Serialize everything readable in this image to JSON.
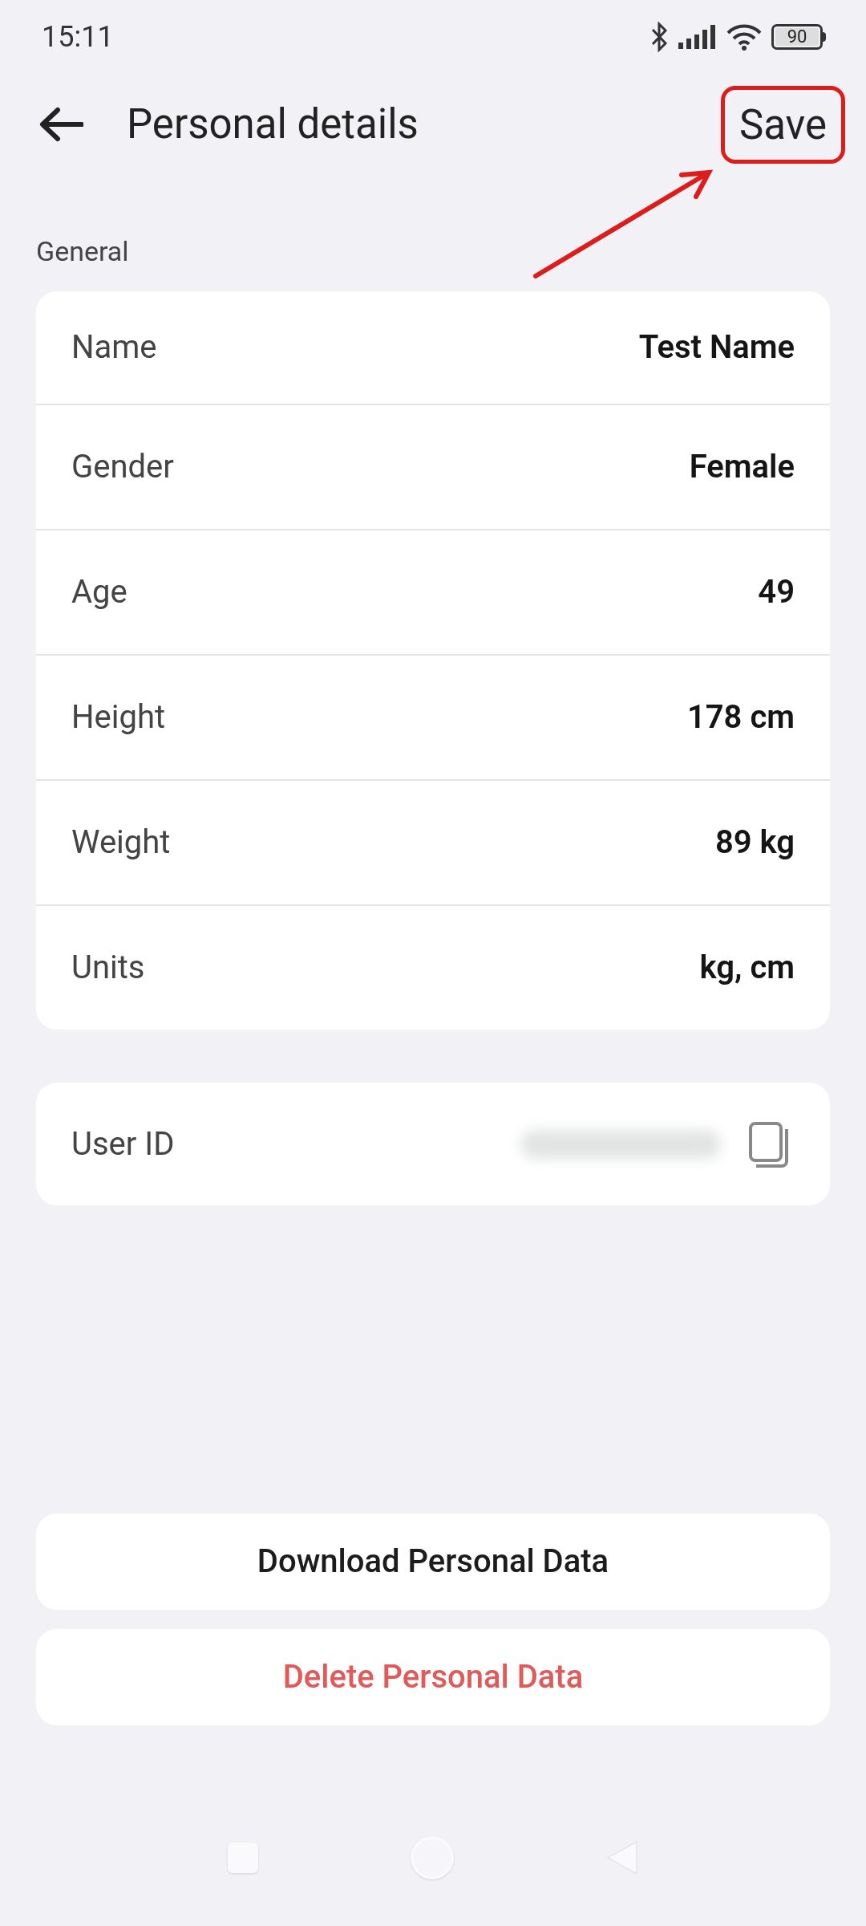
{
  "status_bar": {
    "time": "15:11",
    "battery": "90"
  },
  "header": {
    "title": "Personal details",
    "action": "Save"
  },
  "section_label": "General",
  "fields": [
    {
      "label": "Name",
      "value": "Test Name"
    },
    {
      "label": "Gender",
      "value": "Female"
    },
    {
      "label": "Age",
      "value": "49"
    },
    {
      "label": "Height",
      "value": "178 cm"
    },
    {
      "label": "Weight",
      "value": "89 kg"
    },
    {
      "label": "Units",
      "value": "kg, cm"
    }
  ],
  "user_id": {
    "label": "User ID"
  },
  "buttons": [
    {
      "label": "Download Personal Data",
      "kind": "normal"
    },
    {
      "label": "Delete Personal Data",
      "kind": "danger"
    }
  ]
}
